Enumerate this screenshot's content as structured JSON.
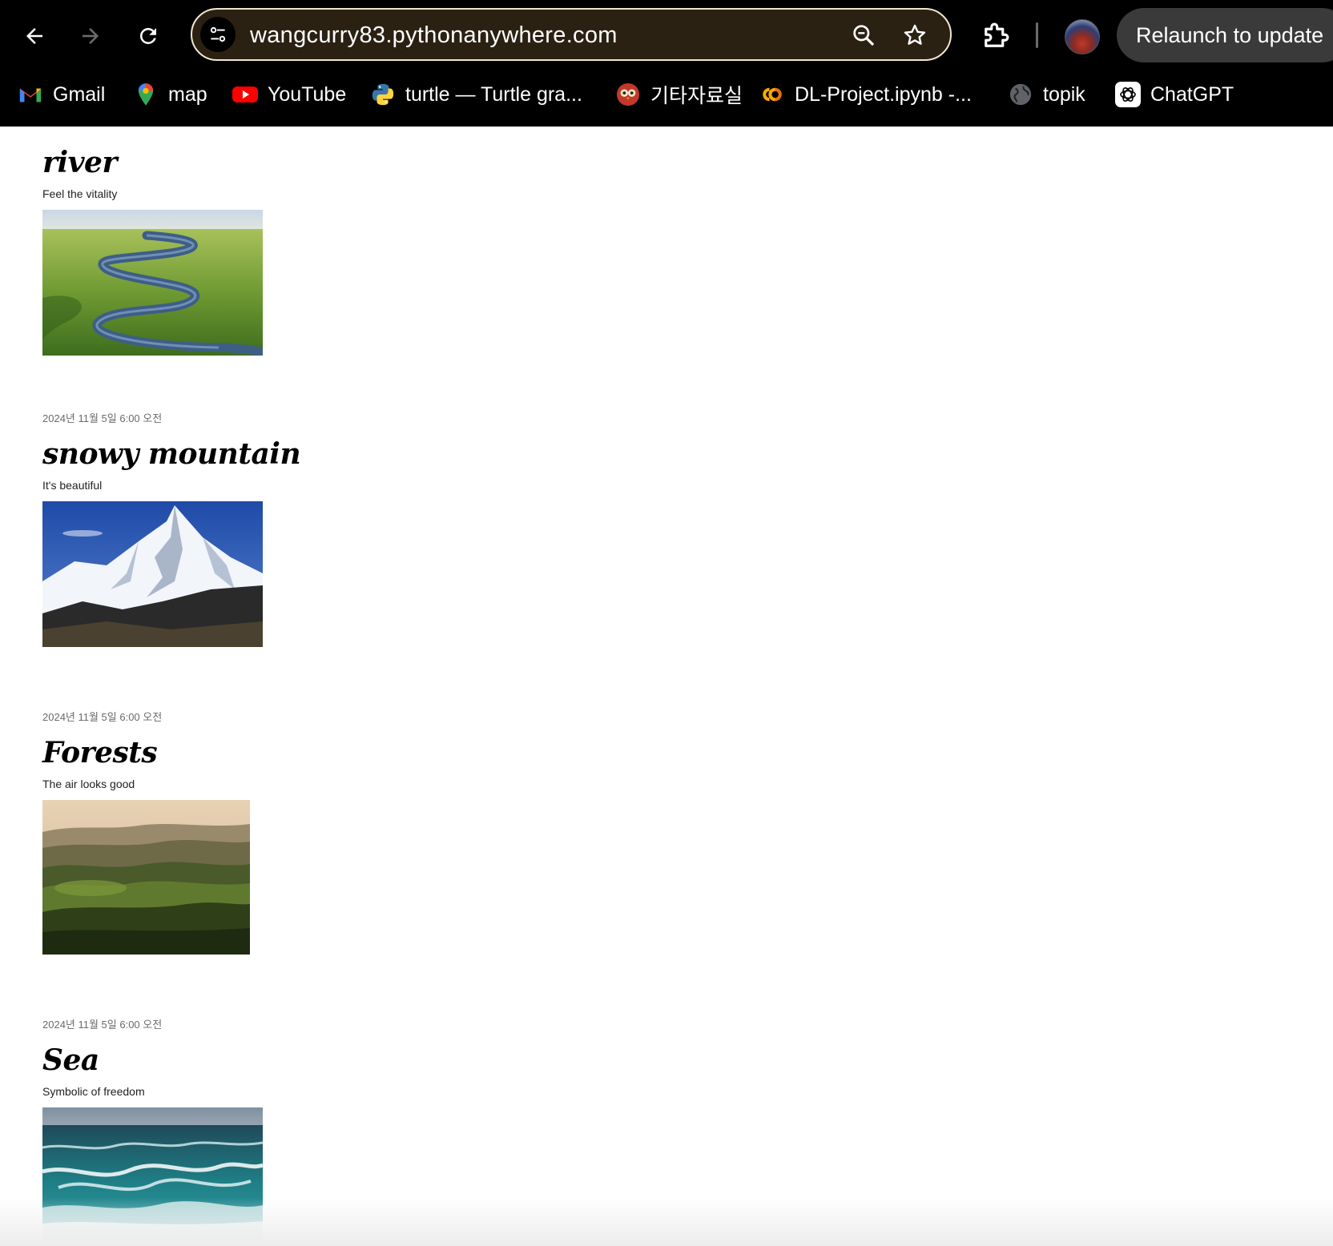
{
  "browser": {
    "url": "wangcurry83.pythonanywhere.com",
    "relaunch_label": "Relaunch to update",
    "icons": {
      "back": "back-arrow-icon",
      "forward": "forward-arrow-icon",
      "reload": "reload-icon",
      "site_info": "tune-icon",
      "zoom": "zoom-icon",
      "bookmark": "star-icon",
      "extensions": "puzzle-icon"
    },
    "bookmarks": [
      {
        "label": "Gmail",
        "icon": "gmail-icon"
      },
      {
        "label": "map",
        "icon": "maps-pin-icon"
      },
      {
        "label": "YouTube",
        "icon": "youtube-icon"
      },
      {
        "label": "turtle — Turtle gra...",
        "icon": "python-icon"
      },
      {
        "label": "기타자료실",
        "icon": "owl-icon"
      },
      {
        "label": "DL-Project.ipynb -...",
        "icon": "colab-icon"
      },
      {
        "label": "topik",
        "icon": "globe-icon"
      },
      {
        "label": "ChatGPT",
        "icon": "chatgpt-icon"
      }
    ]
  },
  "posts": [
    {
      "date": "",
      "title": "river",
      "subtitle": "Feel the vitality",
      "image": "river landscape"
    },
    {
      "date": "2024년 11월 5일 6:00 오전",
      "title": "snowy mountain",
      "subtitle": "It's beautiful",
      "image": "snowy mountain peak"
    },
    {
      "date": "2024년 11월 5일 6:00 오전",
      "title": "Forests",
      "subtitle": "The air looks good",
      "image": "forest hills"
    },
    {
      "date": "2024년 11월 5일 6:00 오전",
      "title": "Sea",
      "subtitle": "Symbolic of freedom",
      "image": "sea waves"
    }
  ]
}
